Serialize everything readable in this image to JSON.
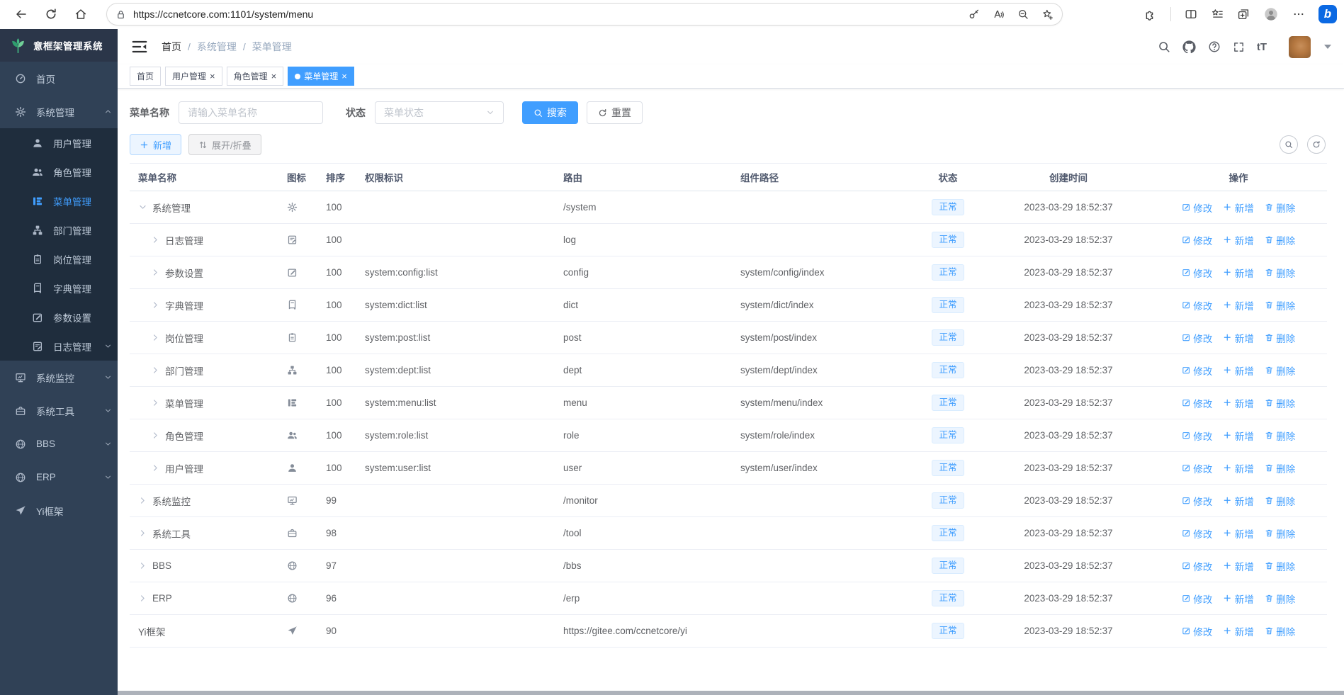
{
  "browser": {
    "url": "https://ccnetcore.com:1101/system/menu"
  },
  "colors": {
    "accent": "#409eff",
    "logo_green": "#42b983",
    "status_bg": "#ecf5ff",
    "sidebar_bg": "#304156",
    "submenu_bg": "#1f2d3d"
  },
  "app": {
    "logo_title": "意框架管理系统",
    "breadcrumb": {
      "sep": "/",
      "items": [
        "首页",
        "系统管理",
        "菜单管理"
      ]
    },
    "font_icon": "tT",
    "close_glyph": "×"
  },
  "sidebar": {
    "items": [
      {
        "label": "首页",
        "icon": "dashboard",
        "chevron": "none"
      },
      {
        "label": "系统管理",
        "icon": "gear",
        "chevron": "up"
      },
      {
        "label": "用户管理",
        "icon": "user",
        "child": true,
        "chevron": "none"
      },
      {
        "label": "角色管理",
        "icon": "peoples",
        "child": true,
        "chevron": "none"
      },
      {
        "label": "菜单管理",
        "icon": "tree-table",
        "child": true,
        "active": true,
        "chevron": "none"
      },
      {
        "label": "部门管理",
        "icon": "tree",
        "child": true,
        "chevron": "none"
      },
      {
        "label": "岗位管理",
        "icon": "post",
        "child": true,
        "chevron": "none"
      },
      {
        "label": "字典管理",
        "icon": "dict",
        "child": true,
        "chevron": "none"
      },
      {
        "label": "参数设置",
        "icon": "edit",
        "child": true,
        "chevron": "none"
      },
      {
        "label": "日志管理",
        "icon": "log",
        "child": true,
        "chevron": "down"
      },
      {
        "label": "系统监控",
        "icon": "monitor",
        "chevron": "down"
      },
      {
        "label": "系统工具",
        "icon": "tool",
        "chevron": "down"
      },
      {
        "label": "BBS",
        "icon": "globe",
        "chevron": "down"
      },
      {
        "label": "ERP",
        "icon": "globe",
        "chevron": "down"
      },
      {
        "label": "Yi框架",
        "icon": "guide",
        "chevron": "none"
      }
    ]
  },
  "tabs": [
    {
      "label": "首页",
      "closable": false
    },
    {
      "label": "用户管理",
      "closable": true
    },
    {
      "label": "角色管理",
      "closable": true
    },
    {
      "label": "菜单管理",
      "closable": true,
      "active": true
    }
  ],
  "filter": {
    "name_label": "菜单名称",
    "name_placeholder": "请输入菜单名称",
    "status_label": "状态",
    "status_placeholder": "菜单状态",
    "search_label": "搜索",
    "reset_label": "重置"
  },
  "toolbar": {
    "add_label": "新增",
    "toggle_label": "展开/折叠"
  },
  "table": {
    "headers": [
      "菜单名称",
      "图标",
      "排序",
      "权限标识",
      "路由",
      "组件路径",
      "状态",
      "创建时间",
      "操作"
    ],
    "actions": {
      "edit": "修改",
      "add": "新增",
      "delete": "删除"
    },
    "rows": [
      {
        "name": "系统管理",
        "icon": "gear",
        "arrow": "down",
        "indent": 0,
        "order": "100",
        "perms": "",
        "route": "/system",
        "component": "",
        "status": "正常",
        "created": "2023-03-29 18:52:37"
      },
      {
        "name": "日志管理",
        "icon": "log",
        "arrow": "right",
        "indent": 1,
        "order": "100",
        "perms": "",
        "route": "log",
        "component": "",
        "status": "正常",
        "created": "2023-03-29 18:52:37"
      },
      {
        "name": "参数设置",
        "icon": "edit",
        "arrow": "right",
        "indent": 1,
        "order": "100",
        "perms": "system:config:list",
        "route": "config",
        "component": "system/config/index",
        "status": "正常",
        "created": "2023-03-29 18:52:37"
      },
      {
        "name": "字典管理",
        "icon": "dict",
        "arrow": "right",
        "indent": 1,
        "order": "100",
        "perms": "system:dict:list",
        "route": "dict",
        "component": "system/dict/index",
        "status": "正常",
        "created": "2023-03-29 18:52:37"
      },
      {
        "name": "岗位管理",
        "icon": "post",
        "arrow": "right",
        "indent": 1,
        "order": "100",
        "perms": "system:post:list",
        "route": "post",
        "component": "system/post/index",
        "status": "正常",
        "created": "2023-03-29 18:52:37"
      },
      {
        "name": "部门管理",
        "icon": "tree",
        "arrow": "right",
        "indent": 1,
        "order": "100",
        "perms": "system:dept:list",
        "route": "dept",
        "component": "system/dept/index",
        "status": "正常",
        "created": "2023-03-29 18:52:37"
      },
      {
        "name": "菜单管理",
        "icon": "tree-table",
        "arrow": "right",
        "indent": 1,
        "order": "100",
        "perms": "system:menu:list",
        "route": "menu",
        "component": "system/menu/index",
        "status": "正常",
        "created": "2023-03-29 18:52:37"
      },
      {
        "name": "角色管理",
        "icon": "peoples",
        "arrow": "right",
        "indent": 1,
        "order": "100",
        "perms": "system:role:list",
        "route": "role",
        "component": "system/role/index",
        "status": "正常",
        "created": "2023-03-29 18:52:37"
      },
      {
        "name": "用户管理",
        "icon": "user",
        "arrow": "right",
        "indent": 1,
        "order": "100",
        "perms": "system:user:list",
        "route": "user",
        "component": "system/user/index",
        "status": "正常",
        "created": "2023-03-29 18:52:37"
      },
      {
        "name": "系统监控",
        "icon": "monitor",
        "arrow": "right",
        "indent": 0,
        "order": "99",
        "perms": "",
        "route": "/monitor",
        "component": "",
        "status": "正常",
        "created": "2023-03-29 18:52:37"
      },
      {
        "name": "系统工具",
        "icon": "tool",
        "arrow": "right",
        "indent": 0,
        "order": "98",
        "perms": "",
        "route": "/tool",
        "component": "",
        "status": "正常",
        "created": "2023-03-29 18:52:37"
      },
      {
        "name": "BBS",
        "icon": "globe",
        "arrow": "right",
        "indent": 0,
        "order": "97",
        "perms": "",
        "route": "/bbs",
        "component": "",
        "status": "正常",
        "created": "2023-03-29 18:52:37"
      },
      {
        "name": "ERP",
        "icon": "globe",
        "arrow": "right",
        "indent": 0,
        "order": "96",
        "perms": "",
        "route": "/erp",
        "component": "",
        "status": "正常",
        "created": "2023-03-29 18:52:37"
      },
      {
        "name": "Yi框架",
        "icon": "guide",
        "arrow": "none",
        "indent": 0,
        "order": "90",
        "perms": "",
        "route": "https://gitee.com/ccnetcore/yi",
        "component": "",
        "status": "正常",
        "created": "2023-03-29 18:52:37"
      }
    ]
  }
}
